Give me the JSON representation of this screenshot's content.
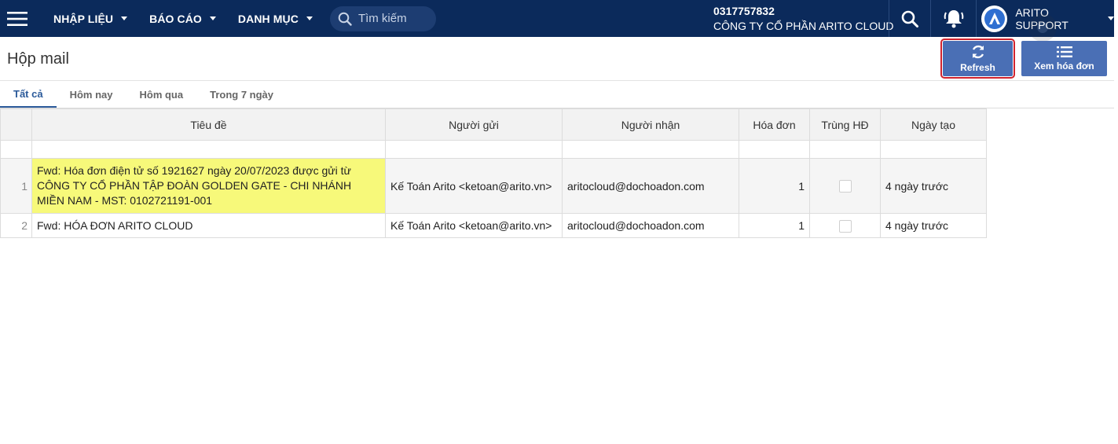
{
  "topbar": {
    "menu": [
      {
        "label": "NHẬP LIỆU"
      },
      {
        "label": "BÁO CÁO"
      },
      {
        "label": "DANH MỤC"
      }
    ],
    "search_placeholder": "Tìm kiếm",
    "company_tax": "0317757832",
    "company_name": "CÔNG TY CỔ PHẦN ARITO CLOUD",
    "user": "ARITO SUPPORT"
  },
  "page": {
    "title": "Hộp mail",
    "refresh_label": "Refresh",
    "view_invoice_label": "Xem hóa đơn"
  },
  "tabs": [
    {
      "label": "Tất cả",
      "active": true
    },
    {
      "label": "Hôm nay"
    },
    {
      "label": "Hôm qua"
    },
    {
      "label": "Trong 7 ngày"
    }
  ],
  "table": {
    "columns": [
      "Tiêu đề",
      "Người gửi",
      "Người nhận",
      "Hóa đơn",
      "Trùng HĐ",
      "Ngày tạo"
    ],
    "rows": [
      {
        "no": "1",
        "title": "Fwd: Hóa đơn điện tử số 1921627 ngày 20/07/2023 được gửi từ CÔNG TY CỔ PHẦN TẬP ĐOÀN GOLDEN GATE - CHI NHÁNH MIỀN NAM - MST: 0102721191-001",
        "sender": "Kế Toán Arito <ketoan@arito.vn>",
        "receiver": "aritocloud@dochoadon.com",
        "invoice": "1",
        "duplicate": false,
        "created": "4 ngày trước"
      },
      {
        "no": "2",
        "title": "Fwd: HÓA ĐƠN ARITO CLOUD",
        "sender": "Kế Toán Arito <ketoan@arito.vn>",
        "receiver": "aritocloud@dochoadon.com",
        "invoice": "1",
        "duplicate": false,
        "created": "4 ngày trước"
      }
    ]
  },
  "colors": {
    "topbar": "#0b2a5b",
    "button": "#4a6fb5",
    "highlight": "#f7f97a",
    "focus_outline": "#d0232f"
  }
}
